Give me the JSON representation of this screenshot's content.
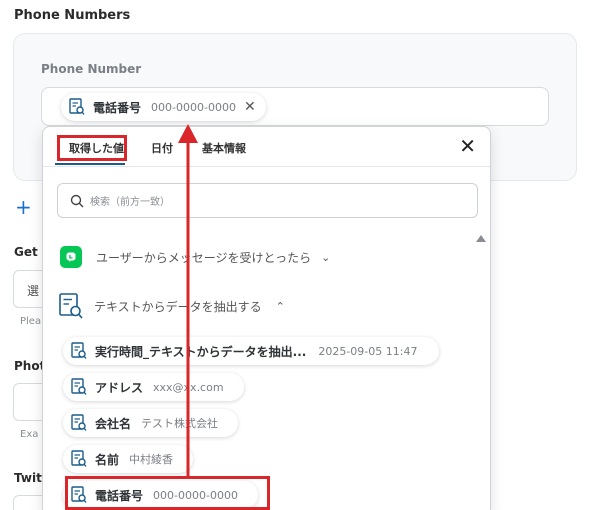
{
  "section": {
    "title": "Phone Numbers"
  },
  "phone_field": {
    "label": "Phone Number",
    "chip": {
      "name": "電話番号",
      "value": "000-0000-0000"
    }
  },
  "background_form": {
    "add_symbol": "+",
    "labels": [
      "Get I",
      "Phot",
      "Twit"
    ],
    "input_placeholder": "選",
    "helper_texts": [
      "Plea",
      "Exa"
    ]
  },
  "dropdown": {
    "tabs": [
      "取得した値",
      "日付",
      "基本情報"
    ],
    "active_tab": "取得した値",
    "search_placeholder": "検索（前方一致）",
    "groups": [
      {
        "label": "ユーザーからメッセージを受けとったら",
        "expanded": false,
        "icon": "line-icon"
      },
      {
        "label": "テキストからデータを抽出する",
        "expanded": true,
        "icon": "document-search-icon"
      }
    ],
    "items": [
      {
        "name": "実行時間_テキストからデータを抽出...",
        "value": "2025-09-05 11:47"
      },
      {
        "name": "アドレス",
        "value": "xxx@xx.com"
      },
      {
        "name": "会社名",
        "value": "テスト株式会社"
      },
      {
        "name": "名前",
        "value": "中村綾香"
      },
      {
        "name": "電話番号",
        "value": "000-0000-0000"
      }
    ]
  },
  "colors": {
    "highlight_red": "#d8262a",
    "accent_blue": "#1a6fd1",
    "line_green": "#06c755"
  }
}
